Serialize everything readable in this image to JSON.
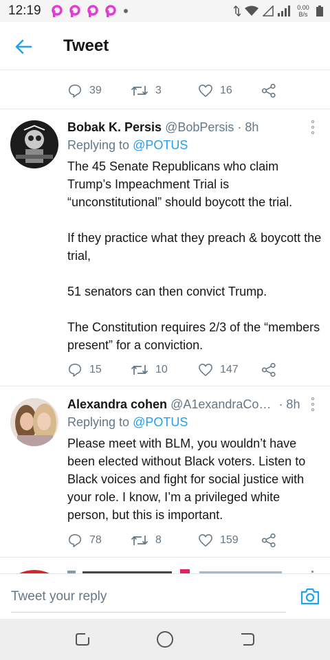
{
  "status_bar": {
    "time": "12:19",
    "network_speed_value": "0.00",
    "network_speed_unit": "B/s",
    "app_icon_color": "#e53bd6"
  },
  "header": {
    "title": "Tweet"
  },
  "previous_tweet": {
    "replies": "39",
    "retweets": "3",
    "likes": "16"
  },
  "tweets": [
    {
      "name": "Bobak K. Persis",
      "handle": "@BobPersis",
      "time": "· 8h",
      "replying_prefix": "Replying to",
      "replying_to": "@POTUS",
      "paragraphs": [
        "The 45 Senate Republicans who claim Trump’s Impeachment Trial is “unconstitutional” should boycott the trial.",
        "If they practice what they preach & boycott the trial,",
        "51 senators can then convict Trump.",
        "The Constitution requires 2/3 of the “members present” for a conviction."
      ],
      "replies": "15",
      "retweets": "10",
      "likes": "147"
    },
    {
      "name": "Alexandra cohen",
      "handle": "@A1exandraCo…",
      "time": "· 8h",
      "replying_prefix": "Replying to",
      "replying_to": "@POTUS",
      "paragraphs": [
        "Please meet with BLM, you wouldn’t have been elected without Black voters. Listen to Black voices and fight for social justice with your role. I know, I’m a privileged white person, but this is important."
      ],
      "replies": "78",
      "retweets": "8",
      "likes": "159"
    }
  ],
  "reply_bar": {
    "placeholder": "Tweet your reply"
  },
  "colors": {
    "accent": "#1da1f2",
    "muted": "#657786",
    "text": "#14171a"
  }
}
